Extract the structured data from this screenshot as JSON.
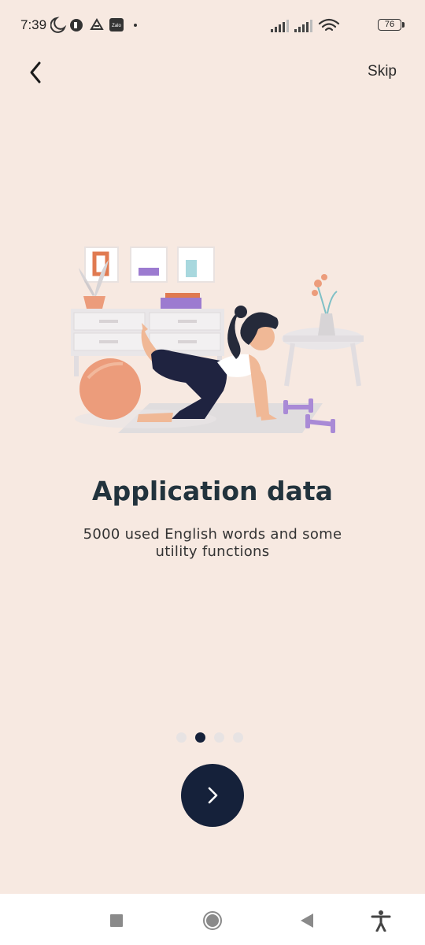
{
  "status_bar": {
    "time": "7:39",
    "battery": "76",
    "icons": [
      "moon-icon",
      "notification-app-icon",
      "drive-icon",
      "zalo-icon",
      "signal-icon",
      "signal-icon",
      "wifi-icon",
      "battery-icon"
    ]
  },
  "header": {
    "back_icon": "chevron-left-icon",
    "skip_label": "Skip"
  },
  "onboarding": {
    "title": "Application data",
    "subtitle": "5000 used English words and some utility functions",
    "page_count": 4,
    "current_page": 2
  },
  "next_button": {
    "icon": "chevron-right-icon"
  },
  "nav_bar": {
    "items": [
      "recents-icon",
      "home-icon",
      "back-icon",
      "accessibility-icon"
    ]
  },
  "colors": {
    "background": "#f7e9e1",
    "primary": "#15213a",
    "title": "#22333d",
    "dot_inactive": "#e7e3e3"
  }
}
